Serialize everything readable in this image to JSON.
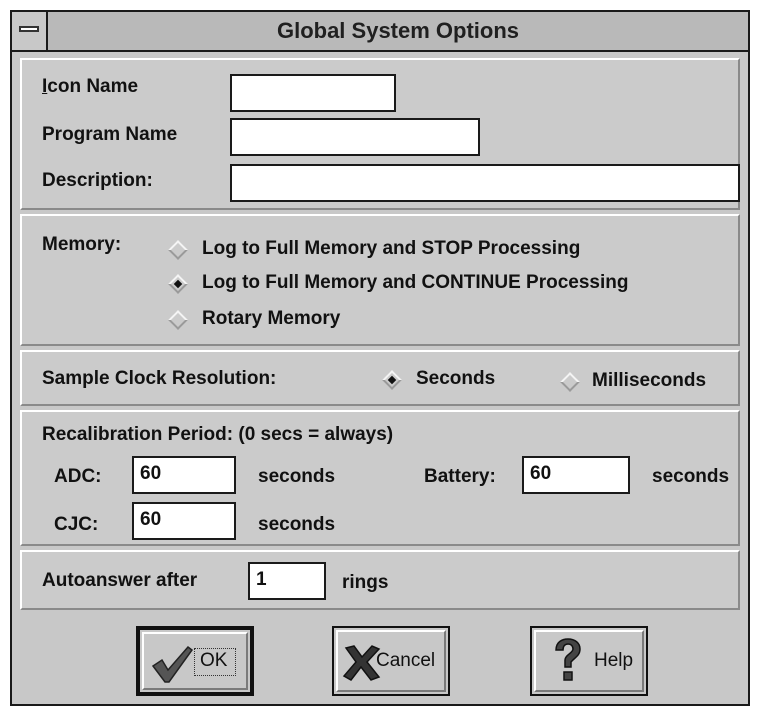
{
  "window": {
    "title": "Global System Options"
  },
  "identity": {
    "icon_name_label": "Icon Name",
    "icon_name_accel": "I",
    "icon_name_rest": "con Name",
    "icon_name_value": "",
    "program_name_label": "Program Name",
    "program_name_value": "",
    "description_label": "Description:",
    "description_value": ""
  },
  "memory": {
    "label": "Memory:",
    "options": [
      {
        "label": "Log to Full Memory and STOP Processing",
        "selected": false
      },
      {
        "label": "Log to Full Memory and CONTINUE Processing",
        "selected": true
      },
      {
        "label": "Rotary Memory",
        "selected": false
      }
    ]
  },
  "clock": {
    "label": "Sample Clock Resolution:",
    "options": [
      {
        "label": "Seconds",
        "selected": true
      },
      {
        "label": "Milliseconds",
        "selected": false
      }
    ]
  },
  "recal": {
    "heading": "Recalibration Period: (0 secs = always)",
    "adc_label": "ADC:",
    "adc_value": "60",
    "battery_label": "Battery:",
    "battery_value": "60",
    "cjc_label": "CJC:",
    "cjc_value": "60",
    "unit": "seconds"
  },
  "autoanswer": {
    "label": "Autoanswer after",
    "value": "1",
    "unit": "rings"
  },
  "buttons": {
    "ok": "OK",
    "cancel": "Cancel",
    "help": "Help"
  },
  "icons": {
    "sysmenu": "system-menu-icon",
    "ok": "checkmark-icon",
    "cancel": "x-icon",
    "help": "question-mark-icon"
  }
}
